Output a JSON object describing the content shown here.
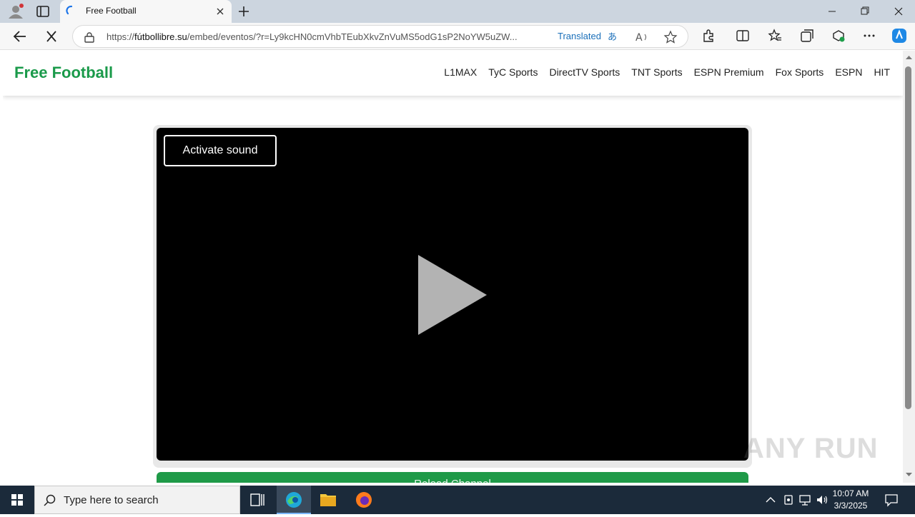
{
  "browser": {
    "tab_title": "Free Football",
    "url_domain": "fútbollibre.su",
    "url_prefix": "https://",
    "url_rest": "/embed/eventos/?r=Ly9kcHN0cmVhbTEubXkvZnVuMS5odG1sP2NoYW5uZW...",
    "translated_label": "Translated"
  },
  "page": {
    "brand": "Free Football",
    "nav": [
      "L1MAX",
      "TyC Sports",
      "DirectTV Sports",
      "TNT Sports",
      "ESPN Premium",
      "Fox Sports",
      "ESPN",
      "HIT"
    ],
    "sound_button": "Activate sound",
    "reload_button": "Reload Channel",
    "watermark": "ANY RUN"
  },
  "taskbar": {
    "search_placeholder": "Type here to search",
    "time": "10:07 AM",
    "date": "3/3/2025"
  },
  "colors": {
    "brand": "#1a9a4a",
    "reload": "#1f9a48",
    "taskbar": "#1b2a3a"
  }
}
